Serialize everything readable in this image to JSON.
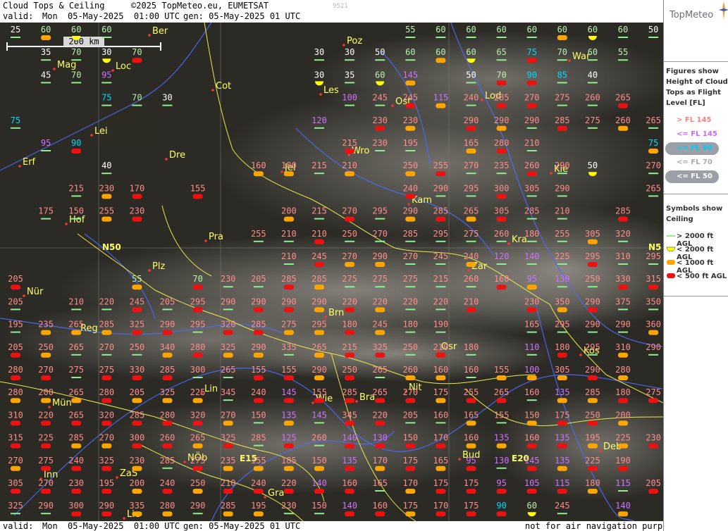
{
  "header": {
    "title": "Cloud Tops & Ceiling",
    "copyright": "©2025 TopMeteo.eu, EUMETSAT",
    "valid_label": "valid:",
    "valid_day": "Mon",
    "valid_datetime": "05-May-2025  01:00 UTC",
    "gen": "gen: 05-May-2025 01 UTC",
    "id": "9521"
  },
  "footer": {
    "valid_label": "valid:",
    "valid_day": "Mon",
    "valid_datetime": "05-May-2025  01:00 UTC",
    "gen": "gen: 05-May-2025 01 UTC",
    "disclaimer": "not for air navigation purposes"
  },
  "brand": "TopMeteo",
  "scale_label": "200 km",
  "grid_labels": [
    "N50",
    "N5",
    "E15",
    "E20"
  ],
  "legend_fl": {
    "title": [
      "Figures show",
      "Height of Cloud",
      "Tops as Flight",
      "Level  [FL]"
    ],
    "items": [
      {
        "label": "> FL 145",
        "color": "#ff8080"
      },
      {
        "label": "<= FL 145",
        "color": "#cc66ff"
      },
      {
        "label": "<= FL 90",
        "color": "#00ccff"
      },
      {
        "label": "<= FL 70",
        "color": "#dddddd"
      },
      {
        "label": "<= FL 50",
        "color": "#ffffff"
      }
    ]
  },
  "legend_ceiling": {
    "title": [
      "Symbols show",
      "Ceiling"
    ],
    "items": [
      {
        "label": "> 2000 ft AGL",
        "color": "#90ee90"
      },
      {
        "label": "< 2000 ft AGL",
        "color": "#ffff00"
      },
      {
        "label": "< 1000 ft AGL",
        "color": "#ffa500"
      },
      {
        "label": "< 500 ft AGL",
        "color": "#ee1111"
      }
    ]
  },
  "cities": [
    "Ber",
    "Poz",
    "Mag",
    "Loc",
    "War",
    "Cot",
    "Les",
    "Lod",
    "Ost",
    "Lei",
    "Erf",
    "Dre",
    "Wro",
    "Jel",
    "Kie",
    "Kam",
    "Hof",
    "Pra",
    "Kra",
    "Plz",
    "Zar",
    "Nür",
    "Brn",
    "Reg",
    "Kos",
    "Osr",
    "Lin",
    "Nit",
    "Mün",
    "Wie",
    "Bra",
    "Bud",
    "Deb",
    "NÖb",
    "Inn",
    "ZaS",
    "Gra",
    "Lie"
  ],
  "values": [
    [
      25,
      60,
      60,
      60,
      null,
      null,
      null,
      null,
      null,
      null,
      null,
      null,
      null,
      55,
      60,
      60,
      60,
      60,
      60,
      60,
      60,
      50
    ],
    [
      null,
      35,
      70,
      30,
      70,
      null,
      null,
      null,
      null,
      null,
      30,
      30,
      50,
      60,
      60,
      60,
      65,
      75,
      70,
      60,
      55,
      null
    ],
    [
      null,
      45,
      70,
      95,
      null,
      null,
      null,
      null,
      null,
      null,
      30,
      35,
      60,
      145,
      null,
      50,
      70,
      90,
      85,
      40,
      null,
      null
    ],
    [
      null,
      null,
      null,
      75,
      70,
      30,
      null,
      null,
      null,
      null,
      null,
      100,
      245,
      245,
      115,
      240,
      285,
      270,
      275,
      260,
      265,
      null
    ],
    [
      75,
      null,
      null,
      null,
      null,
      null,
      null,
      null,
      null,
      null,
      120,
      null,
      230,
      230,
      null,
      290,
      290,
      290,
      285,
      275,
      260,
      265
    ],
    [
      null,
      95,
      90,
      null,
      null,
      null,
      null,
      null,
      null,
      null,
      null,
      215,
      230,
      195,
      null,
      165,
      280,
      210,
      null,
      null,
      null,
      75
    ],
    [
      null,
      null,
      null,
      40,
      null,
      null,
      null,
      null,
      160,
      180,
      215,
      210,
      null,
      250,
      255,
      270,
      235,
      260,
      290,
      50,
      null,
      270
    ],
    [
      null,
      null,
      215,
      230,
      170,
      null,
      155,
      null,
      null,
      null,
      null,
      null,
      null,
      240,
      290,
      295,
      300,
      305,
      290,
      null,
      null,
      265
    ],
    [
      null,
      175,
      150,
      255,
      230,
      null,
      null,
      null,
      null,
      200,
      215,
      270,
      295,
      290,
      285,
      265,
      305,
      285,
      210,
      null,
      285,
      null
    ],
    [
      null,
      null,
      null,
      null,
      null,
      null,
      null,
      null,
      255,
      210,
      210,
      250,
      270,
      285,
      295,
      275,
      260,
      180,
      255,
      305,
      320,
      null
    ],
    [
      null,
      null,
      null,
      null,
      null,
      null,
      null,
      null,
      null,
      210,
      245,
      270,
      290,
      270,
      245,
      240,
      120,
      140,
      225,
      295,
      310,
      295
    ],
    [
      205,
      null,
      null,
      null,
      55,
      null,
      70,
      230,
      205,
      285,
      285,
      275,
      275,
      275,
      215,
      260,
      160,
      95,
      130,
      250,
      330,
      315
    ],
    [
      205,
      null,
      210,
      220,
      245,
      205,
      295,
      290,
      290,
      290,
      290,
      220,
      220,
      220,
      220,
      210,
      null,
      230,
      350,
      290,
      375,
      350
    ],
    [
      195,
      235,
      265,
      285,
      325,
      290,
      295,
      320,
      285,
      275,
      295,
      180,
      245,
      180,
      190,
      null,
      null,
      165,
      295,
      290,
      290,
      360
    ],
    [
      205,
      250,
      265,
      270,
      250,
      340,
      280,
      325,
      290,
      335,
      265,
      215,
      325,
      250,
      210,
      180,
      null,
      110,
      180,
      295,
      310,
      290
    ],
    [
      280,
      270,
      275,
      275,
      330,
      285,
      300,
      265,
      155,
      155,
      290,
      250,
      265,
      260,
      160,
      160,
      155,
      100,
      305,
      290,
      280,
      null
    ],
    [
      280,
      200,
      265,
      280,
      205,
      325,
      225,
      345,
      240,
      145,
      155,
      285,
      265,
      270,
      175,
      255,
      265,
      160,
      135,
      285,
      180,
      275
    ],
    [
      310,
      220,
      265,
      320,
      285,
      280,
      320,
      270,
      150,
      135,
      145,
      345,
      220,
      205,
      160,
      165,
      155,
      150,
      175,
      250,
      200,
      null
    ],
    [
      315,
      225,
      285,
      270,
      300,
      260,
      265,
      325,
      285,
      125,
      260,
      140,
      130,
      150,
      170,
      160,
      135,
      160,
      135,
      195,
      225,
      230
    ],
    [
      270,
      275,
      240,
      325,
      230,
      285,
      275,
      235,
      155,
      185,
      150,
      135,
      170,
      175,
      165,
      95,
      130,
      145,
      135,
      225,
      190,
      null
    ],
    [
      305,
      270,
      230,
      195,
      200,
      240,
      250,
      210,
      240,
      220,
      140,
      160,
      165,
      170,
      175,
      175,
      95,
      105,
      115,
      180,
      115,
      205
    ],
    [
      325,
      290,
      300,
      290,
      335,
      280,
      290,
      285,
      195,
      230,
      150,
      140,
      160,
      175,
      170,
      175,
      90,
      60,
      245,
      null,
      140,
      null
    ]
  ]
}
